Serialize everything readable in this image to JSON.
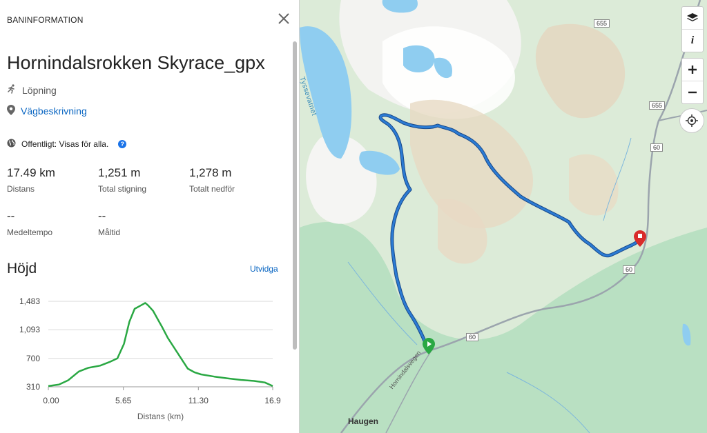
{
  "panel": {
    "title": "BANINFORMATION",
    "course_name": "Hornindalsrokken Skyrace_gpx",
    "activity": "Löpning",
    "directions_link": "Vägbeskrivning",
    "visibility": "Offentligt: Visas för alla."
  },
  "stats": {
    "distance": {
      "value": "17.49 km",
      "label": "Distans"
    },
    "ascent": {
      "value": "1,251 m",
      "label": "Total stigning"
    },
    "descent": {
      "value": "1,278 m",
      "label": "Totalt nedför"
    },
    "pace": {
      "value": "--",
      "label": "Medeltempo"
    },
    "goal_time": {
      "value": "--",
      "label": "Måltid"
    }
  },
  "elevation": {
    "title": "Höjd",
    "expand_label": "Utvidga"
  },
  "chart_data": {
    "type": "area",
    "xlabel": "Distans (km)",
    "ylabel": "",
    "y_ticks": [
      "1,483",
      "1,093",
      "700",
      "310"
    ],
    "x_ticks": [
      "0.00",
      "5.65",
      "11.30",
      "16.9"
    ],
    "xlim": [
      0,
      16.9
    ],
    "ylim": [
      310,
      1483
    ],
    "x": [
      0,
      0.8,
      1.5,
      2.3,
      3.0,
      3.9,
      4.6,
      5.2,
      5.7,
      6.1,
      6.5,
      6.9,
      7.3,
      7.5,
      7.7,
      7.9,
      8.2,
      8.6,
      9.0,
      9.5,
      10.0,
      10.5,
      11.0,
      11.5,
      12.5,
      13.5,
      14.5,
      15.5,
      16.3,
      16.9
    ],
    "y": [
      320,
      340,
      400,
      520,
      570,
      600,
      650,
      700,
      900,
      1200,
      1380,
      1420,
      1460,
      1430,
      1390,
      1350,
      1250,
      1120,
      980,
      840,
      700,
      560,
      510,
      480,
      450,
      425,
      405,
      390,
      370,
      320
    ],
    "line_color": "#2aa843"
  },
  "map": {
    "labels": {
      "lake": "Tyssevatnet",
      "town": "Haugen",
      "road_name": "Hornindalsvegen",
      "road_60": "60",
      "road_655": "655"
    },
    "route_color": "#2b7bd4"
  }
}
